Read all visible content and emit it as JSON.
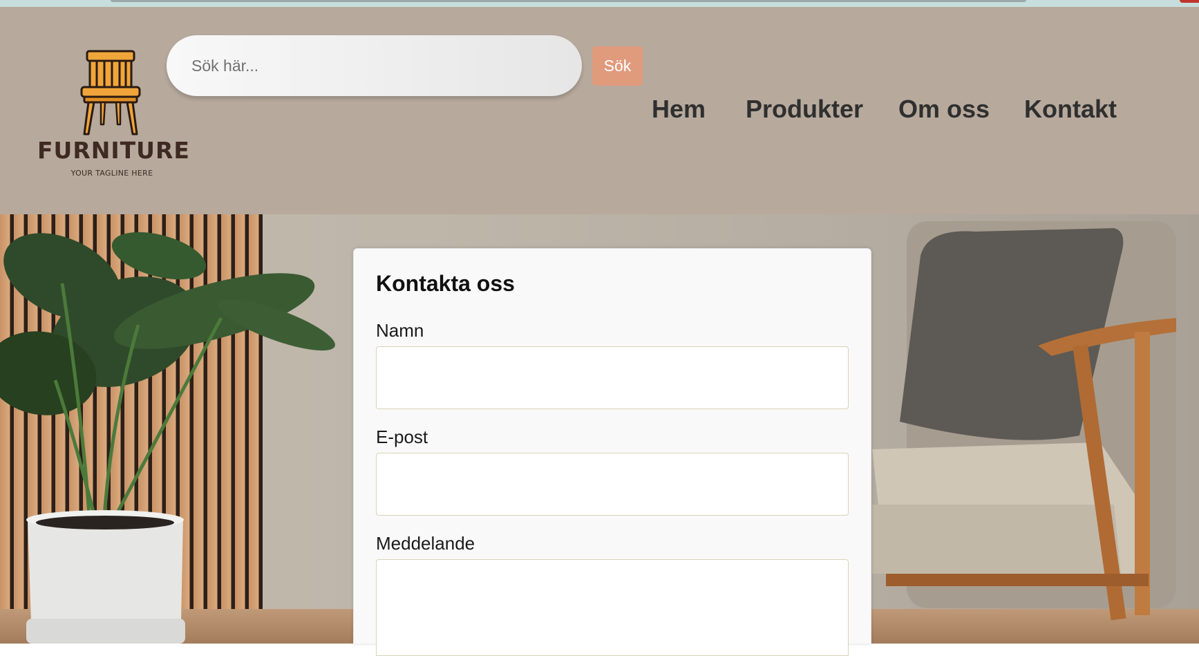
{
  "header": {
    "logo": {
      "brand": "FURNITURE",
      "tagline": "YOUR TAGLINE HERE",
      "icon": "chair-icon"
    },
    "search": {
      "placeholder": "Sök här...",
      "button_label": "Sök"
    },
    "nav": [
      {
        "label": "Hem"
      },
      {
        "label": "Produkter"
      },
      {
        "label": "Om oss"
      },
      {
        "label": "Kontakt"
      }
    ]
  },
  "contact_form": {
    "title": "Kontakta oss",
    "fields": [
      {
        "label": "Namn",
        "value": ""
      },
      {
        "label": "E-post",
        "value": ""
      },
      {
        "label": "Meddelande",
        "value": ""
      }
    ]
  },
  "colors": {
    "header_bg": "#b7a99c",
    "search_button": "#e09a7c",
    "nav_text": "#2f2f2f",
    "brand_text": "#3e2a22",
    "chair_orange": "#f0a53a"
  }
}
